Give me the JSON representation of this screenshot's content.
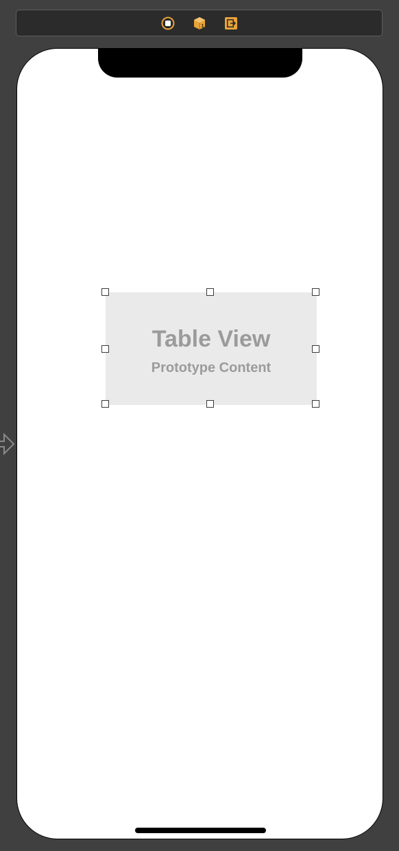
{
  "scene_dock": {
    "icons": [
      "view-controller-icon",
      "first-responder-icon",
      "exit-icon"
    ],
    "accent_color": "#e8a33a"
  },
  "canvas": {
    "background": "#404040"
  },
  "device": {
    "screen_color": "#ffffff"
  },
  "table_view": {
    "title": "Table View",
    "subtitle": "Prototype Content",
    "background": "#eaeaea",
    "text_color": "#9b9b9b"
  }
}
